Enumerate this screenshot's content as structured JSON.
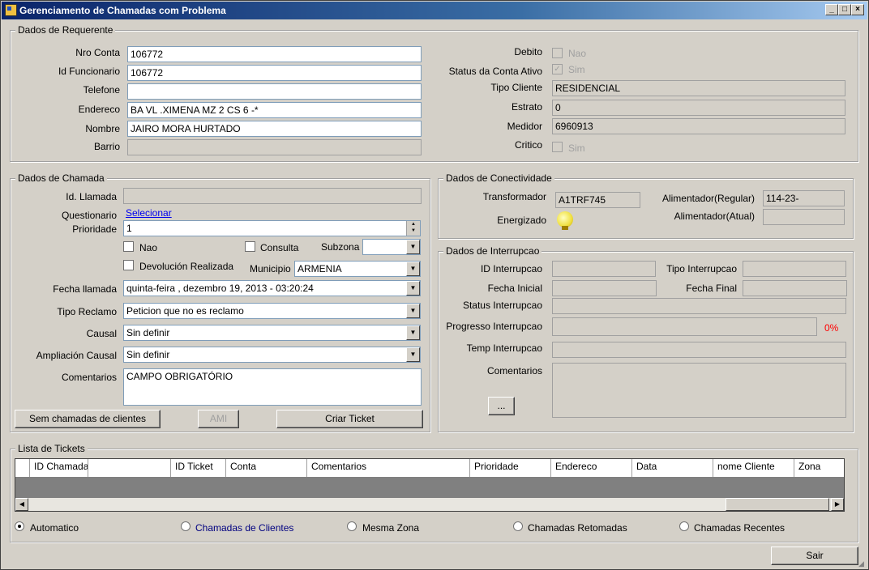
{
  "window": {
    "title": "Gerenciamento de Chamadas com Problema"
  },
  "requerente": {
    "legend": "Dados de Requerente",
    "nro_conta_label": "Nro Conta",
    "nro_conta": "106772",
    "id_func_label": "Id Funcionario",
    "id_func": "106772",
    "telefone_label": "Telefone",
    "telefone": "",
    "endereco_label": "Endereco",
    "endereco": "BA VL .XIMENA MZ 2  CS 6 -*",
    "nombre_label": "Nombre",
    "nombre": "JAIRO MORA HURTADO",
    "barrio_label": "Barrio",
    "barrio": "",
    "debito_label": "Debito",
    "debito_chk": "Nao",
    "status_label": "Status da Conta Ativo",
    "status_chk": "Sim",
    "tipo_cliente_label": "Tipo Cliente",
    "tipo_cliente": "RESIDENCIAL",
    "estrato_label": "Estrato",
    "estrato": "0",
    "medidor_label": "Medidor",
    "medidor": "6960913",
    "critico_label": "Critico",
    "critico_chk": "Sim"
  },
  "chamada": {
    "legend": "Dados de Chamada",
    "id_llamada_label": "Id. Llamada",
    "id_llamada": "",
    "questionario_label": "Questionario",
    "questionario_link": "Selecionar",
    "prioridade_label": "Prioridade",
    "prioridade": "1",
    "nao_label": "Nao",
    "consulta_label": "Consulta",
    "subzona_label": "Subzona",
    "subzona": "",
    "devolucion_label": "Devolución Realizada",
    "municipio_label": "Municipio",
    "municipio": "ARMENIA",
    "fecha_label": "Fecha llamada",
    "fecha": "quinta-feira  , dezembro  19, 2013 - 03:20:24",
    "tipo_reclamo_label": "Tipo Reclamo",
    "tipo_reclamo": "Peticion que no es reclamo",
    "causal_label": "Causal",
    "causal": "Sin definir",
    "ampliacion_label": "Ampliación Causal",
    "ampliacion": "Sin definir",
    "comentarios_label": "Comentarios",
    "comentarios": "CAMPO OBRIGATÓRIO",
    "btn_sem": "Sem chamadas de clientes",
    "btn_ami": "AMI",
    "btn_criar": "Criar Ticket"
  },
  "conectividade": {
    "legend": "Dados de Conectividade",
    "transformador_label": "Transformador",
    "transformador": "A1TRF745",
    "alim_regular_label": "Alimentador(Regular)",
    "alim_regular": "114-23-",
    "energizado_label": "Energizado",
    "alim_atual_label": "Alimentador(Atual)",
    "alim_atual": ""
  },
  "interrupcao": {
    "legend": "Dados de Interrupcao",
    "id_label": "ID Interrupcao",
    "tipo_label": "Tipo Interrupcao",
    "fecha_ini_label": "Fecha Inicial",
    "fecha_fin_label": "Fecha Final",
    "status_label": "Status Interrupcao",
    "progresso_label": "Progresso Interrupcao",
    "progresso": "0%",
    "temp_label": "Temp Interrupcao",
    "comentarios_label": "Comentarios",
    "btn_more": "..."
  },
  "tickets": {
    "legend": "Lista de Tickets",
    "columns": [
      "ID Chamada",
      "",
      "ID Ticket",
      "Conta",
      "Comentarios",
      "Prioridade",
      "Endereco",
      "Data",
      "nome Cliente",
      "Zona"
    ],
    "radios": [
      "Automatico",
      "Chamadas de Clientes",
      "Mesma Zona",
      "Chamadas Retomadas",
      "Chamadas Recentes"
    ]
  },
  "footer": {
    "sair": "Sair"
  }
}
